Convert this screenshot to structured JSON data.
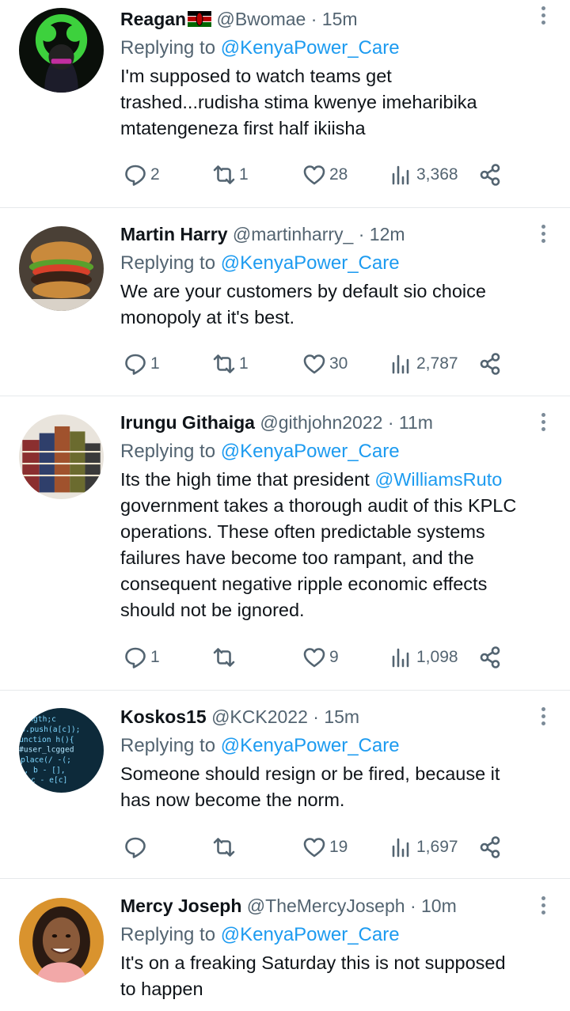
{
  "tweets": [
    {
      "name": "Reagan",
      "handle": "@Bwomae",
      "time": "15m",
      "replying_label": "Replying to",
      "replying_to": "@KenyaPower_Care",
      "body_parts": [
        "I'm supposed to watch teams get",
        "trashed...rudisha stima kwenye imeharibika",
        "mtatengeneza first half ikiisha"
      ],
      "replies": "2",
      "retweets": "1",
      "likes": "28",
      "views": "3,368"
    },
    {
      "name": "Martin Harry",
      "handle": "@martinharry_",
      "time": "12m",
      "replying_label": "Replying to",
      "replying_to": "@KenyaPower_Care",
      "body_parts": [
        "We are your customers by default sio choice",
        "monopoly at it's best."
      ],
      "replies": "1",
      "retweets": "1",
      "likes": "30",
      "views": "2,787"
    },
    {
      "name": "Irungu Githaiga",
      "handle": "@githjohn2022",
      "time": "11m",
      "replying_label": "Replying to",
      "replying_to": "@KenyaPower_Care",
      "body_before": "Its the high time that president ",
      "body_mention": "@WilliamsRuto",
      "body_parts": [
        "government takes a thorough audit of this KPLC",
        "operations. These often predictable systems",
        "failures have become too rampant, and the",
        "consequent negative ripple economic effects",
        "should not be ignored."
      ],
      "replies": "1",
      "retweets": "",
      "likes": "9",
      "views": "1,098"
    },
    {
      "name": "Koskos15",
      "handle": "@KCK2022",
      "time": "15m",
      "replying_label": "Replying to",
      "replying_to": "@KenyaPower_Care",
      "body_parts": [
        "Someone should resign or be fired, because it",
        "has now become the norm."
      ],
      "replies": "",
      "retweets": "",
      "likes": "19",
      "views": "1,697"
    },
    {
      "name": "Mercy Joseph",
      "handle": "@TheMercyJoseph",
      "time": "10m",
      "replying_label": "Replying to",
      "replying_to": "@KenyaPower_Care",
      "body_parts": [
        "It's on a freaking Saturday this is not supposed",
        "to happen"
      ]
    }
  ],
  "separator": "·",
  "colors": {
    "text": "#0f1419",
    "secondary": "#536471",
    "link": "#1d9bf0",
    "divider": "#e6e9eb"
  },
  "icons": [
    "reply-icon",
    "retweet-icon",
    "like-icon",
    "views-icon",
    "share-icon",
    "more-icon",
    "kenya-flag-icon"
  ]
}
